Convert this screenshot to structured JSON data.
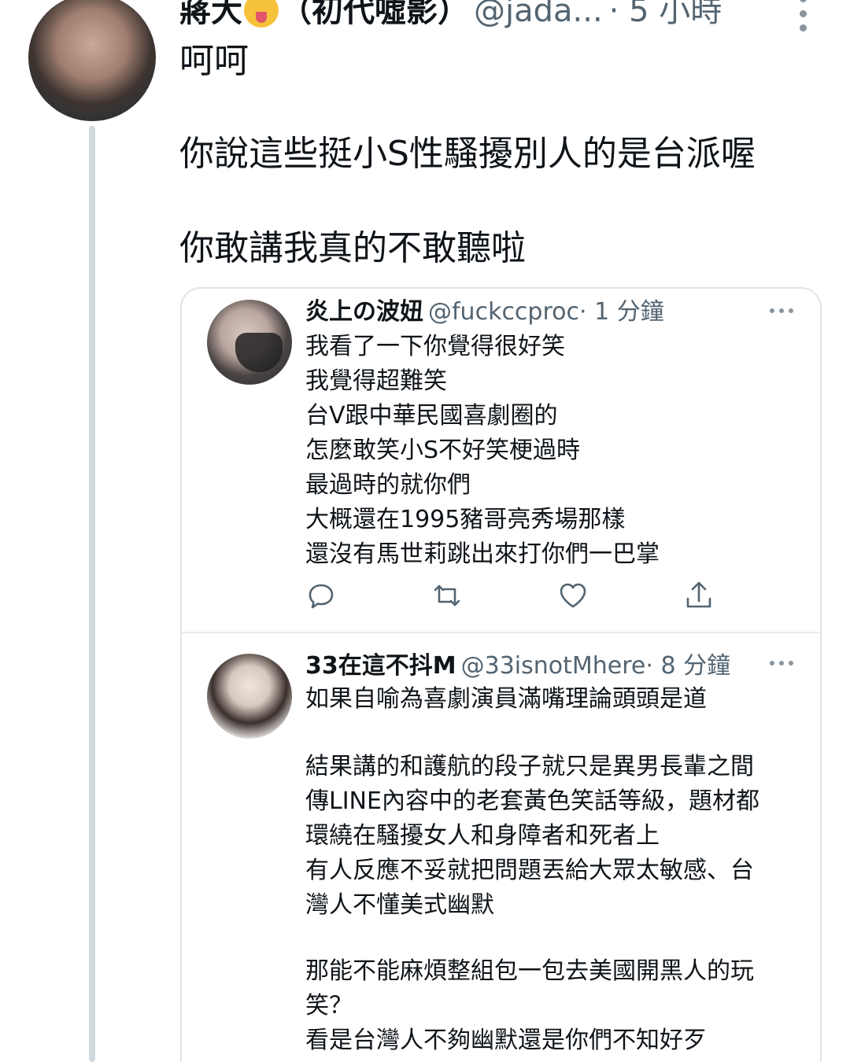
{
  "main_tweet": {
    "author_name": "蔣大",
    "author_suffix": "（初代噓影）",
    "handle": "@jada...",
    "time": "· 5 小時",
    "lines": [
      "呵呵",
      "你說這些挺小S性騷擾別人的是台派喔",
      "你敢講我真的不敢聽啦"
    ]
  },
  "quotes": [
    {
      "name": "炎上の波妞",
      "handle": "@fuckccproc",
      "time": "· 1 分鐘",
      "lines": [
        "我看了一下你覺得很好笑",
        "我覺得超難笑",
        "台V跟中華民國喜劇圈的",
        "怎麼敢笑小S不好笑梗過時",
        "最過時的就你們",
        "大概還在1995豬哥亮秀場那樣",
        "還沒有馬世莉跳出來打你們一巴掌"
      ],
      "actions": [
        "reply-icon",
        "retweet-icon",
        "like-icon",
        "share-icon"
      ]
    },
    {
      "name": "33在這不抖M",
      "handle": "@33isnotMhere",
      "time": "· 8 分鐘",
      "lines": [
        "如果自喻為喜劇演員滿嘴理論頭頭是道",
        "",
        "結果講的和護航的段子就只是異男長輩之間",
        "傳LINE內容中的老套黃色笑話等級，題材都",
        "環繞在騷擾女人和身障者和死者上",
        "有人反應不妥就把問題丟給大眾太敏感、台",
        "灣人不懂美式幽默",
        "",
        "那能不能麻煩整組包一包去美國開黑人的玩",
        "笑？",
        "看是台灣人不夠幽默還是你們不知好歹"
      ]
    }
  ],
  "colors": {
    "text": "#0f1419",
    "muted": "#536471",
    "border": "#dfe4e8",
    "thread_line": "#cfd9de"
  }
}
